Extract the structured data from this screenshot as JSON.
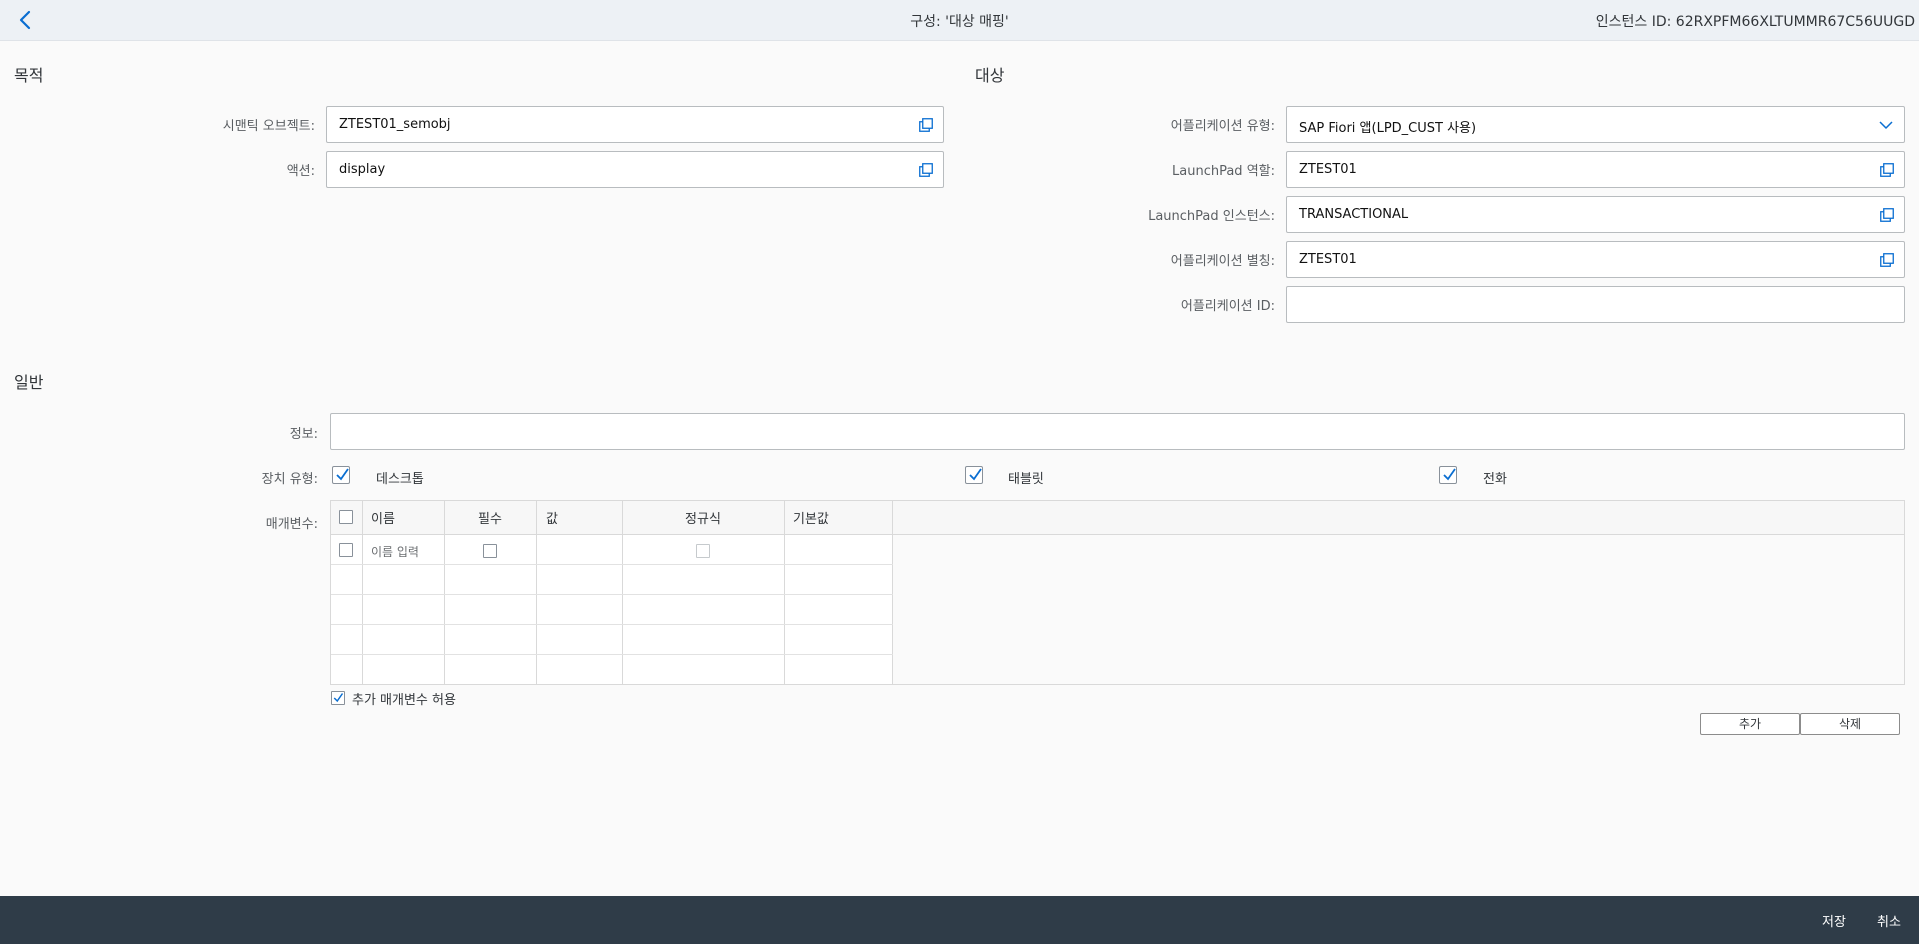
{
  "header": {
    "title": "구성: '대상 매핑'",
    "instance_id": "인스턴스 ID: 62RXPFM66XLTUMMR67C56UUGD"
  },
  "sections": {
    "purpose": "목적",
    "target": "대상",
    "general": "일반"
  },
  "purpose": {
    "semantic_object_label": "시맨틱 오브젝트:",
    "semantic_object_value": "ZTEST01_semobj",
    "action_label": "액션:",
    "action_value": "display"
  },
  "target": {
    "app_type_label": "어플리케이션 유형:",
    "app_type_value": "SAP Fiori 앱(LPD_CUST 사용)",
    "launchpad_role_label": "LaunchPad 역할:",
    "launchpad_role_value": "ZTEST01",
    "launchpad_instance_label": "LaunchPad 인스턴스:",
    "launchpad_instance_value": "TRANSACTIONAL",
    "app_alias_label": "어플리케이션 별칭:",
    "app_alias_value": "ZTEST01",
    "app_id_label": "어플리케이션 ID:",
    "app_id_value": ""
  },
  "general": {
    "info_label": "정보:",
    "info_value": "",
    "device_type_label": "장치 유형:",
    "devices": {
      "desktop": "데스크톱",
      "tablet": "태블릿",
      "phone": "전화"
    },
    "params_label": "매개변수:",
    "columns": {
      "name": "이름",
      "required": "필수",
      "value": "값",
      "regex": "정규식",
      "default": "기본값"
    },
    "row_placeholder": "이름 입력",
    "allow_additional_label": "추가 매개변수 허용",
    "add_button": "추가",
    "delete_button": "삭제"
  },
  "footer": {
    "save": "저장",
    "cancel": "취소"
  },
  "colors": {
    "accent": "#0a6ed1",
    "header_bg": "#edf1f5",
    "footer_bg": "#2f3c48"
  },
  "icons": {
    "back": "chevron-left-icon",
    "value_help": "value-help-icon",
    "dropdown": "chevron-down-icon",
    "check": "checkmark-icon"
  }
}
